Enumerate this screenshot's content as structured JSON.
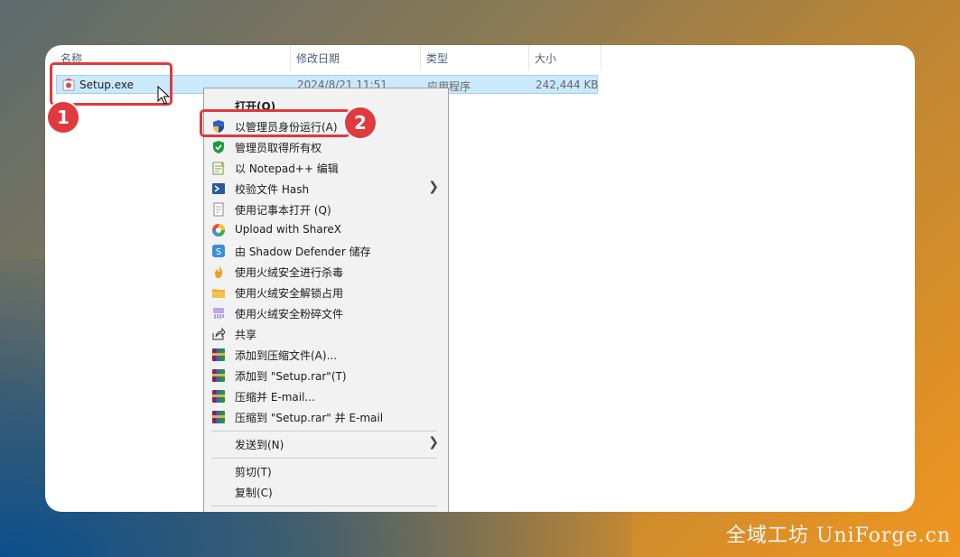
{
  "watermark": "全域工坊 UniForge.cn",
  "columns": {
    "name": "名称",
    "date": "修改日期",
    "type": "类型",
    "size": "大小"
  },
  "file": {
    "name": "Setup.exe",
    "date": "2024/8/21 11:51",
    "type": "应用程序",
    "size": "242,444 KB"
  },
  "badges": {
    "one": "1",
    "two": "2"
  },
  "menu": {
    "items": [
      {
        "label": "打开(O)",
        "icon": "none",
        "bold": true
      },
      {
        "label": "以管理员身份运行(A)",
        "icon": "uac-shield-icon"
      },
      {
        "label": "管理员取得所有权",
        "icon": "green-shield-icon"
      },
      {
        "label": "以 Notepad++ 编辑",
        "icon": "notepadpp-icon"
      },
      {
        "label": "校验文件 Hash",
        "icon": "powershell-icon",
        "submenu": true
      },
      {
        "label": "使用记事本打开 (Q)",
        "icon": "notepad-icon"
      },
      {
        "label": "Upload with ShareX",
        "icon": "sharex-icon"
      },
      {
        "label": "由 Shadow Defender 储存",
        "icon": "shadow-defender-icon"
      },
      {
        "label": "使用火绒安全进行杀毒",
        "icon": "huorong-icon"
      },
      {
        "label": "使用火绒安全解锁占用",
        "icon": "folder-unlock-icon"
      },
      {
        "label": "使用火绒安全粉碎文件",
        "icon": "shredder-icon"
      },
      {
        "label": "共享",
        "icon": "share-icon"
      },
      {
        "label": "添加到压缩文件(A)...",
        "icon": "winrar-icon"
      },
      {
        "label": "添加到 \"Setup.rar\"(T)",
        "icon": "winrar-icon"
      },
      {
        "label": "压缩并 E-mail...",
        "icon": "winrar-icon"
      },
      {
        "label": "压缩到 \"Setup.rar\" 并 E-mail",
        "icon": "winrar-icon"
      },
      {
        "label": "发送到(N)",
        "icon": "none",
        "submenu": true
      },
      {
        "label": "剪切(T)",
        "icon": "none"
      },
      {
        "label": "复制(C)",
        "icon": "none"
      }
    ]
  },
  "colors": {
    "highlight": "#e0393e",
    "selection": "#cce8ff"
  }
}
